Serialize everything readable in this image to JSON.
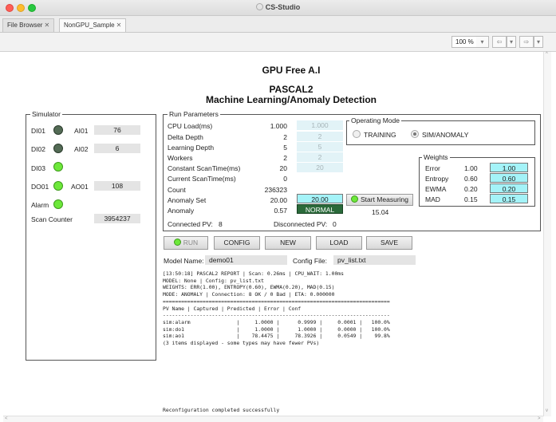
{
  "window": {
    "title": "CS-Studio"
  },
  "tabs": [
    {
      "label": "File Browser",
      "close": "✕"
    },
    {
      "label": "NonGPU_Sample",
      "close": "✕"
    }
  ],
  "toolbar": {
    "zoom": "100 %"
  },
  "header": {
    "title1": "GPU Free A.I",
    "title2": "PASCAL2",
    "title3": "Machine Learning/Anomaly Detection"
  },
  "simulator": {
    "title": "Simulator",
    "di01": "DI01",
    "di02": "DI02",
    "di03": "DI03",
    "do01": "DO01",
    "alarm": "Alarm",
    "ai01": "AI01",
    "ai01_value": "76",
    "ai02": "AI02",
    "ai02_value": "6",
    "ao01": "AO01",
    "ao01_value": "108",
    "scan_counter_label": "Scan Counter",
    "scan_counter_value": "3954237"
  },
  "run_params": {
    "title": "Run Parameters",
    "rows": [
      {
        "label": "CPU Load(ms)",
        "value": "1.000",
        "setpoint": "1.000"
      },
      {
        "label": "Delta Depth",
        "value": "2",
        "setpoint": "2"
      },
      {
        "label": "Learning Depth",
        "value": "5",
        "setpoint": "5"
      },
      {
        "label": "Workers",
        "value": "2",
        "setpoint": "2"
      },
      {
        "label": "Constant ScanTime(ms)",
        "value": "20",
        "setpoint": "20"
      },
      {
        "label": "Current ScanTime(ms)",
        "value": "0"
      },
      {
        "label": "Count",
        "value": "236323"
      },
      {
        "label": "Anomaly Set",
        "value": "20.00",
        "setpoint": "20.00"
      },
      {
        "label": "Anomaly",
        "value": "0.57",
        "status": "NORMAL"
      }
    ],
    "start_measuring": "Start Measuring",
    "measured_value": "15.04",
    "connected_label": "Connected PV:",
    "connected_value": "8",
    "disconnected_label": "Disconnected PV:",
    "disconnected_value": "0"
  },
  "operating_mode": {
    "title": "Operating Mode",
    "options": [
      "TRAINING",
      "SIM/ANOMALY"
    ],
    "selected": "SIM/ANOMALY"
  },
  "weights": {
    "title": "Weights",
    "rows": [
      {
        "label": "Error",
        "value": "1.00",
        "setpoint": "1.00"
      },
      {
        "label": "Entropy",
        "value": "0.60",
        "setpoint": "0.60"
      },
      {
        "label": "EWMA",
        "value": "0.20",
        "setpoint": "0.20"
      },
      {
        "label": "MAD",
        "value": "0.15",
        "setpoint": "0.15"
      }
    ]
  },
  "buttons": {
    "run": "RUN",
    "config": "CONFIG",
    "new": "NEW",
    "load": "LOAD",
    "save": "SAVE"
  },
  "model": {
    "name_label": "Model Name:",
    "name_value": "demo01",
    "config_label": "Config File:",
    "config_value": "pv_list.txt"
  },
  "report_lines": [
    "[13:50:18] PASCAL2 REPORT | Scan: 0.26ms | CPU_WAIT: 1.00ms",
    "MODEL: None | Config: pv_list.txt",
    "WEIGHTS: ERR(1.00), ENTROPY(0.60), EWMA(0.20), MAD(0.15)",
    "MODE: ANOMALY | Connection: 8 OK / 0 Bad | ETA: 0.000000",
    "==========================================================================",
    "PV Name | Captured | Predicted | Error | Conf",
    "--------------------------------------------------------------------------",
    "sim:alarm               |     1.0000 |      0.9999 |     0.0001 |   100.0%",
    "sim:do1                 |     1.0000 |      1.0000 |     0.0000 |   100.0%",
    "sim:ao1                 |    78.4475 |     78.3926 |     0.0549 |    99.8%",
    "(3 items displayed - some types may have fewer PVs)"
  ],
  "status_text": "Reconfiguration completed successfully"
}
